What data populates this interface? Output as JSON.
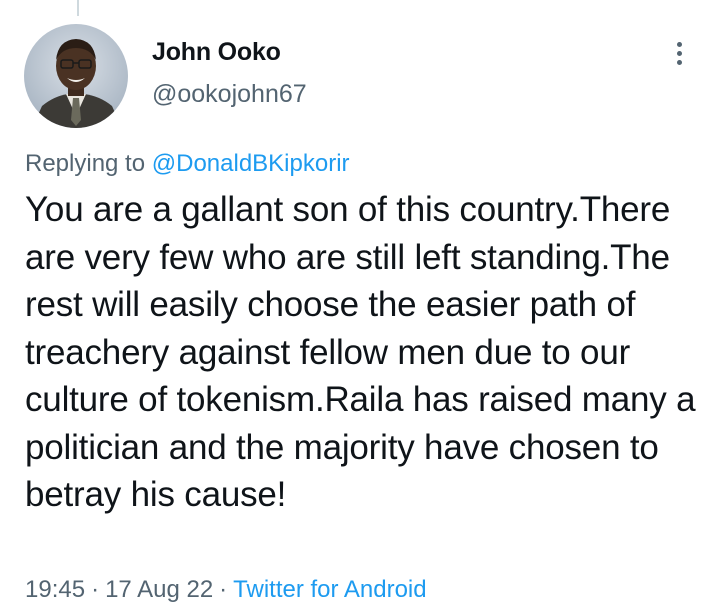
{
  "user": {
    "name": "John Ooko",
    "handle": "@ookojohn67"
  },
  "reply": {
    "prefix": "Replying to",
    "mention": "@DonaldBKipkorir"
  },
  "tweet": {
    "text": "You are a gallant son of this country.There are very few who are still left standing.The rest will easily choose the easier path of treachery against fellow men due to our culture of tokenism.Raila has raised many a politician and the majority have chosen to betray his cause!"
  },
  "meta": {
    "time": "19:45",
    "date": "17 Aug 22",
    "separator": "·",
    "source": "Twitter for Android"
  },
  "icons": {
    "more": "more-vertical-icon"
  },
  "colors": {
    "accent": "#1d9bf0",
    "secondary_text": "#536471",
    "primary_text": "#0f1419"
  }
}
